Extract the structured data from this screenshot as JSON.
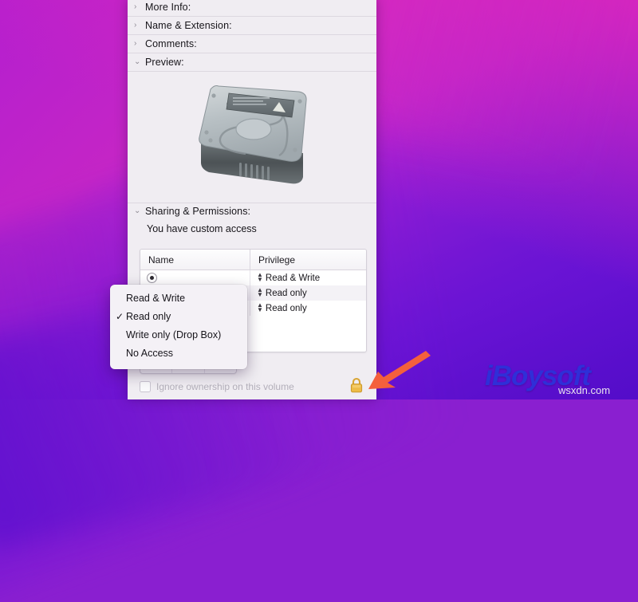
{
  "window": {
    "sections": [
      {
        "label": "More Info:",
        "expanded": false,
        "triangle": "›"
      },
      {
        "label": "Name & Extension:",
        "expanded": false,
        "triangle": "›"
      },
      {
        "label": "Comments:",
        "expanded": false,
        "triangle": "›"
      },
      {
        "label": "Preview:",
        "expanded": true,
        "triangle": "⌄"
      }
    ],
    "preview": {
      "icon_name": "hard-drive-icon"
    },
    "sharing": {
      "header_label": "Sharing & Permissions:",
      "header_triangle": "⌄",
      "access_summary": "You have custom access",
      "table": {
        "columns": [
          "Name",
          "Privilege"
        ],
        "rows": [
          {
            "name": "",
            "privilege": "Read & Write",
            "selected": true
          },
          {
            "name": "",
            "privilege": "Read only",
            "selected": false
          },
          {
            "name": "",
            "privilege": "Read only",
            "selected": false
          }
        ]
      },
      "footer": {
        "add_label": "+",
        "remove_label": "–",
        "action_label": "⚙",
        "ignore_ownership_label": "Ignore ownership on this volume",
        "ignore_ownership_checked": false,
        "lock_state": "locked",
        "lock_color": "#e8b13c"
      }
    }
  },
  "dropdown": {
    "items": [
      {
        "label": "Read & Write",
        "checked": false
      },
      {
        "label": "Read only",
        "checked": true
      },
      {
        "label": "Write only (Drop Box)",
        "checked": false
      },
      {
        "label": "No Access",
        "checked": false
      }
    ],
    "check_glyph": "✓"
  },
  "annotation": {
    "arrow_color": "#f4603c"
  },
  "watermark": {
    "brand": "iBoysoft",
    "site": "wsxdn.com"
  },
  "colors": {
    "wallpaper_magenta": "#c425c6",
    "wallpaper_purple": "#6f18d6",
    "panel_bg": "#f0edf2",
    "lock_yellow": "#e8b13c",
    "arrow_red": "#f4603c",
    "brand_blue": "#2f2fd8"
  }
}
